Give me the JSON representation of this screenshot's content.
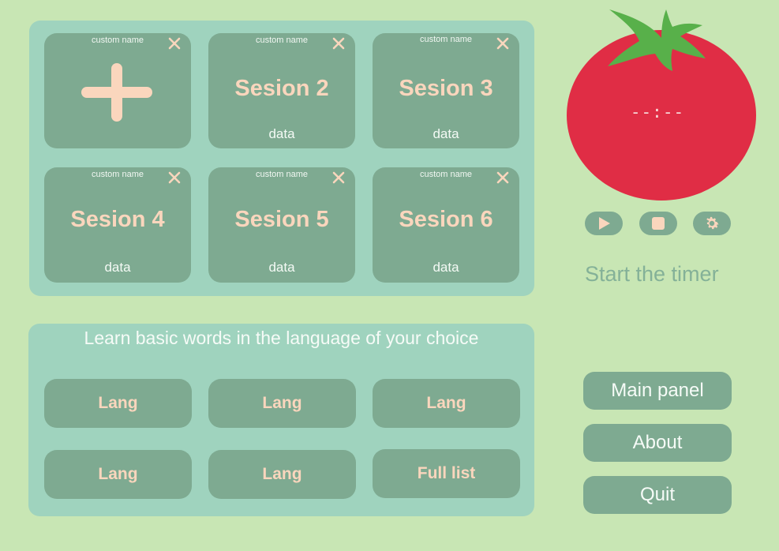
{
  "sessions": {
    "cards": [
      {
        "custom_name": "custom name",
        "title": "",
        "data": "",
        "icon": "plus-icon"
      },
      {
        "custom_name": "custom name",
        "title": "Sesion 2",
        "data": "data"
      },
      {
        "custom_name": "custom name",
        "title": "Sesion 3",
        "data": "data"
      },
      {
        "custom_name": "custom name",
        "title": "Sesion 4",
        "data": "data"
      },
      {
        "custom_name": "custom name",
        "title": "Sesion 5",
        "data": "data"
      },
      {
        "custom_name": "custom name",
        "title": "Sesion 6",
        "data": "data"
      }
    ],
    "close_icon": "close-icon"
  },
  "languages": {
    "heading": "Learn basic words in the language of your choice",
    "buttons": [
      "Lang",
      "Lang",
      "Lang",
      "Lang",
      "Lang",
      "Full list"
    ]
  },
  "timer": {
    "display": "--:--",
    "status": "Start the timer",
    "controls": [
      "play-icon",
      "stop-icon",
      "gear-icon"
    ]
  },
  "nav": {
    "main_panel": "Main panel",
    "about": "About",
    "quit": "Quit"
  },
  "colors": {
    "background": "#c8e6b4",
    "panel": "#9fd3be",
    "card": "#7eaa91",
    "accent_text": "#fad6bd",
    "tomato": "#e02d45",
    "leaf": "#58b04a"
  }
}
